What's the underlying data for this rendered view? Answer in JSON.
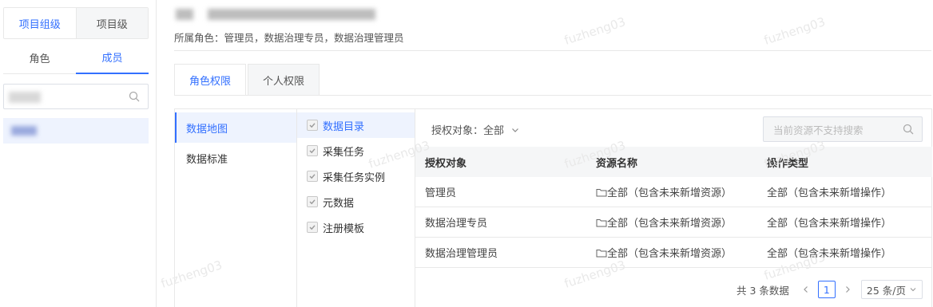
{
  "left_panel": {
    "scope_tabs": [
      "项目组级",
      "项目级"
    ],
    "sub_tabs": [
      "角色",
      "成员"
    ]
  },
  "header": {
    "roles_label": "所属角色：管理员，数据治理专员，数据治理管理员"
  },
  "main_tabs": [
    "角色权限",
    "个人权限"
  ],
  "categories": [
    "数据地图",
    "数据标准"
  ],
  "resources": [
    "数据目录",
    "采集任务",
    "采集任务实例",
    "元数据",
    "注册模板"
  ],
  "filter": {
    "label": "授权对象：全部"
  },
  "search": {
    "placeholder": "当前资源不支持搜索"
  },
  "table": {
    "headers": [
      "授权对象",
      "资源名称",
      "操作类型"
    ],
    "rows": [
      [
        "管理员",
        "全部（包含未来新增资源）",
        "全部（包含未来新增操作）"
      ],
      [
        "数据治理专员",
        "全部（包含未来新增资源）",
        "全部（包含未来新增操作）"
      ],
      [
        "数据治理管理员",
        "全部（包含未来新增资源）",
        "全部（包含未来新增操作）"
      ]
    ]
  },
  "pagination": {
    "total_label": "共 3 条数据",
    "current_page": "1",
    "page_size_label": "25 条/页"
  },
  "watermark": "fuzheng03",
  "colors": {
    "accent": "#3370ff"
  }
}
